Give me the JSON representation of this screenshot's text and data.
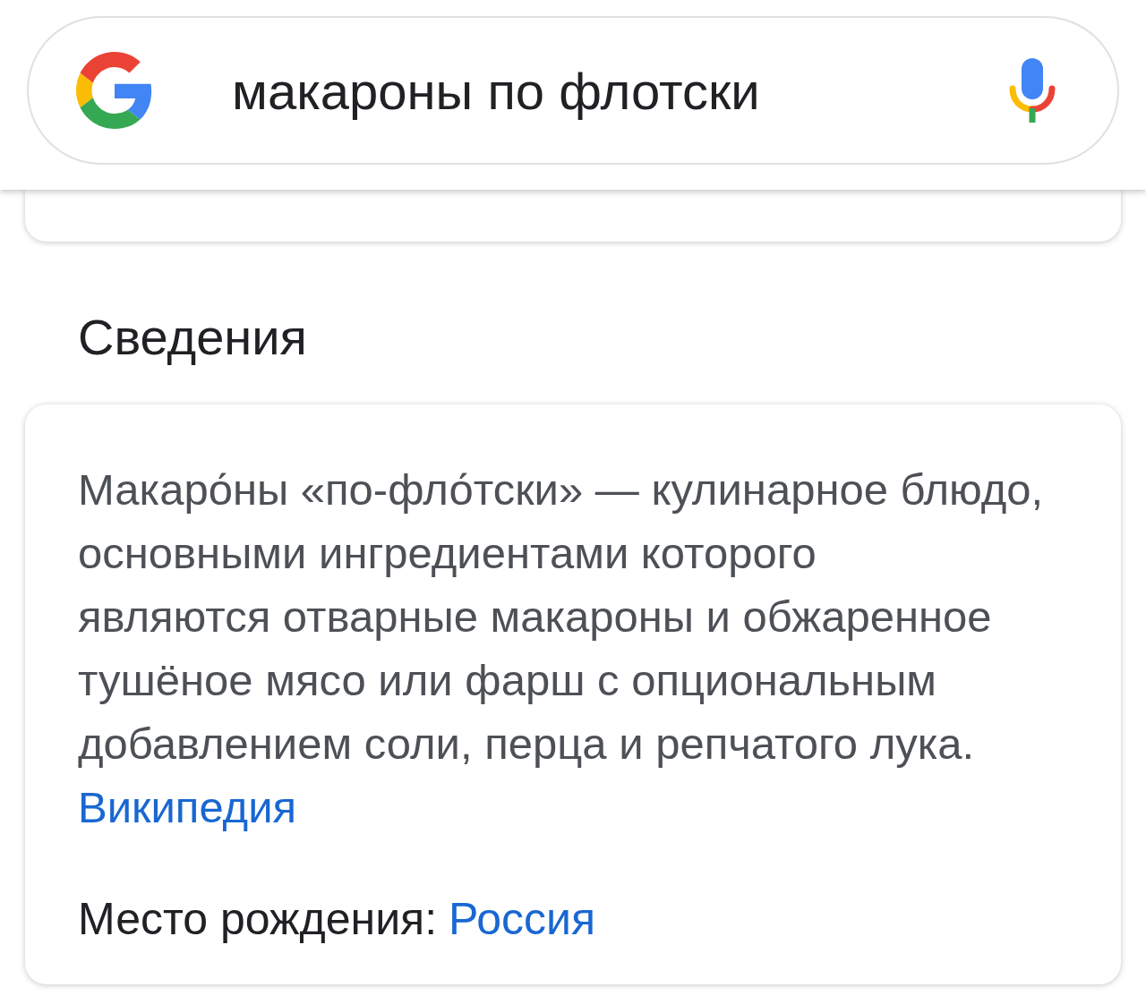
{
  "search_bar": {
    "query": "макароны по флотски"
  },
  "section_title": "Сведения",
  "description": {
    "lines": [
      "Макаро́ны «по-фло́тски» — кулинарное блюдо,",
      "основными ингредиентами которого",
      "являются отварные макароны и обжаренное",
      "тушёное мясо или фарш с опциональным",
      "добавлением соли, перца и репчатого лука."
    ],
    "source_link": "Википедия"
  },
  "facts": [
    {
      "label": "Место рождения:",
      "value": "Россия"
    }
  ]
}
